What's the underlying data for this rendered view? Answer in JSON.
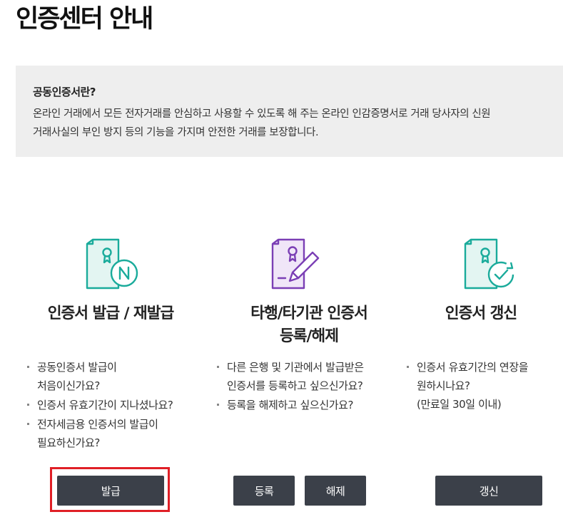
{
  "page": {
    "title": "인증센터 안내"
  },
  "info": {
    "title": "공동인증서란?",
    "lines": [
      "온라인 거래에서 모든 전자거래를 안심하고 사용할 수 있도록 해 주는 온라인 인감증명서로 거래 당사자의 신원",
      "거래사실의 부인 방지 등의 기능을 가지며 안전한 거래를 보장합니다."
    ]
  },
  "cards": [
    {
      "title_lines": [
        "인증서 발급 / 재발급"
      ],
      "icon": "certificate-new-icon",
      "icon_color": "#1aab9b",
      "bullets": [
        [
          "공동인증서 발급이",
          "처음이신가요?"
        ],
        [
          "인증서 유효기간이 지나셨나요?"
        ],
        [
          "전자세금용 인증서의 발급이",
          "필요하신가요?"
        ]
      ],
      "buttons": [
        "발급"
      ]
    },
    {
      "title_lines": [
        "타행/타기관 인증서",
        "등록/해제"
      ],
      "icon": "certificate-edit-icon",
      "icon_color": "#7b3fb5",
      "bullets": [
        [
          "다른 은행 및 기관에서 발급받은",
          "인증서를 등록하고 싶으신가요?"
        ],
        [
          "등록을 해제하고 싶으신가요?"
        ]
      ],
      "buttons": [
        "등록",
        "해제"
      ]
    },
    {
      "title_lines": [
        "인증서 갱신"
      ],
      "icon": "certificate-renew-icon",
      "icon_color": "#1aab9b",
      "bullets": [
        [
          "인증서 유효기간의 연장을",
          "원하시나요?"
        ]
      ],
      "note": "(만료일 30일 이내)",
      "buttons": [
        "갱신"
      ]
    }
  ],
  "colors": {
    "button_bg": "#3b4049",
    "highlight": "#e01f26",
    "info_bg": "#eeeeee",
    "teal": "#1aab9b",
    "purple": "#7b3fb5"
  }
}
